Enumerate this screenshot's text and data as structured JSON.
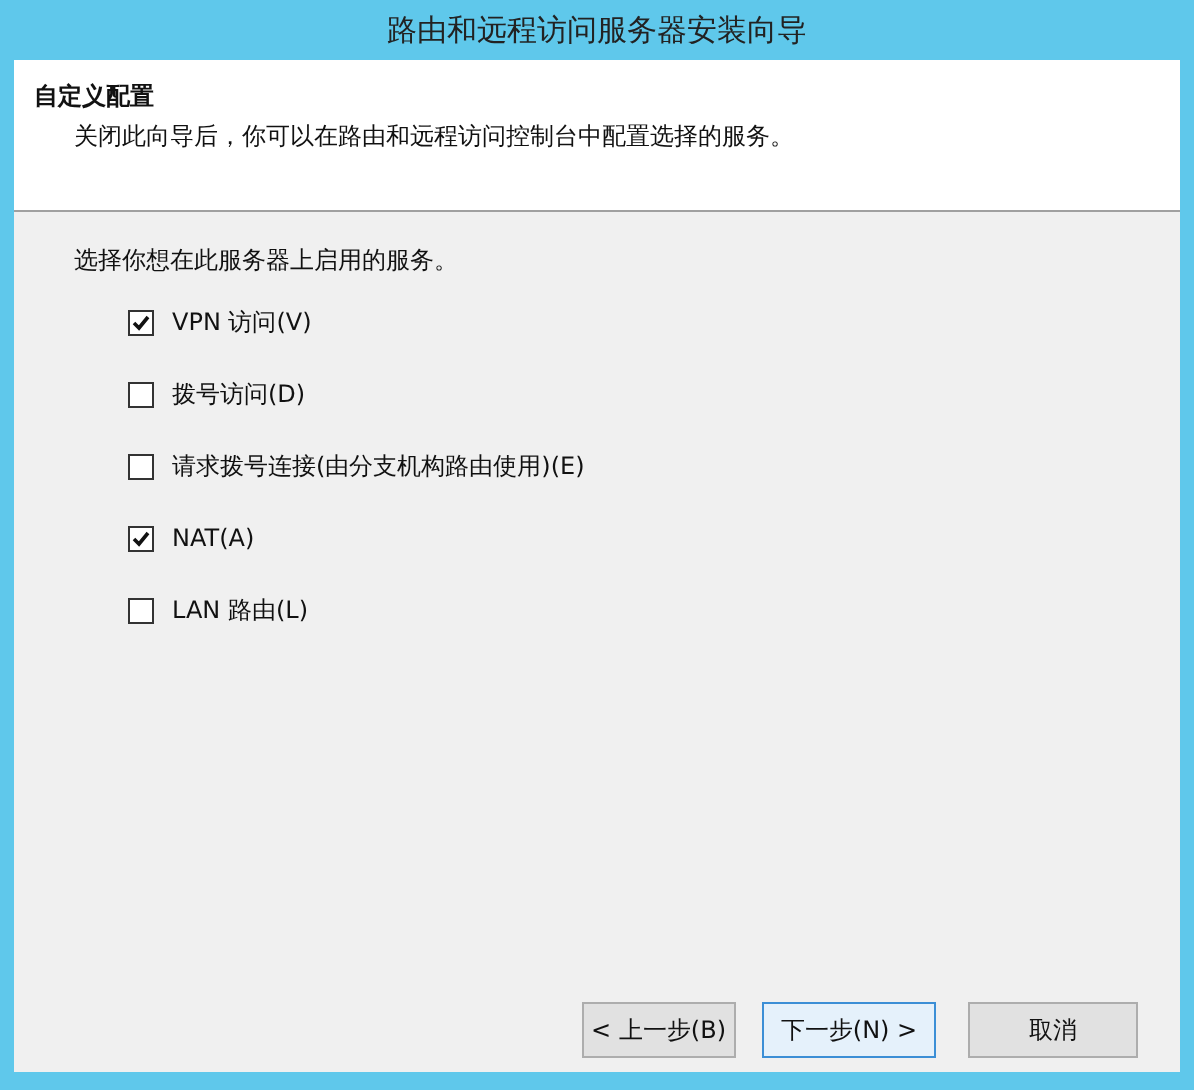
{
  "window": {
    "title": "路由和远程访问服务器安装向导"
  },
  "header": {
    "title": "自定义配置",
    "subtitle": "关闭此向导后，你可以在路由和远程访问控制台中配置选择的服务。"
  },
  "prompt": "选择你想在此服务器上启用的服务。",
  "services": [
    {
      "label": "VPN 访问(V)",
      "checked": true
    },
    {
      "label": "拨号访问(D)",
      "checked": false
    },
    {
      "label": "请求拨号连接(由分支机构路由使用)(E)",
      "checked": false
    },
    {
      "label": "NAT(A)",
      "checked": true
    },
    {
      "label": "LAN 路由(L)",
      "checked": false
    }
  ],
  "buttons": [
    {
      "label": "< 上一步(B)",
      "kind": "back",
      "focused": false
    },
    {
      "label": "下一步(N) >",
      "kind": "next",
      "focused": true
    },
    {
      "label": "取消",
      "kind": "cancel",
      "focused": false
    }
  ]
}
